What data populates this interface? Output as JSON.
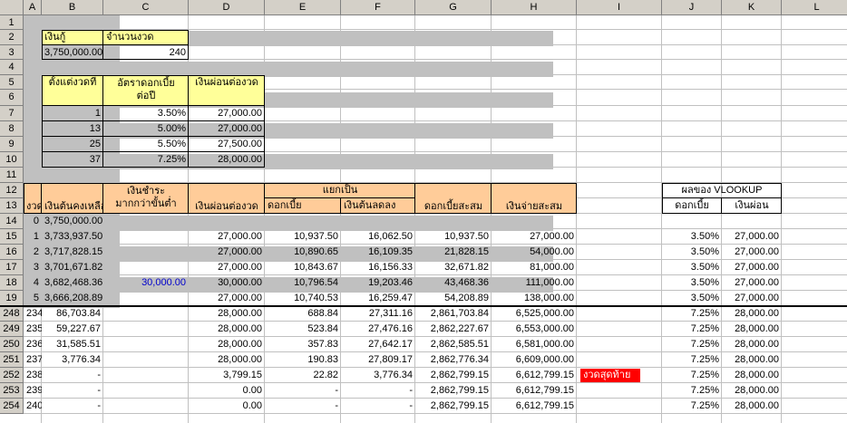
{
  "columns": [
    "A",
    "B",
    "C",
    "D",
    "E",
    "F",
    "G",
    "H",
    "I",
    "J",
    "K",
    "L"
  ],
  "row_numbers": [
    "1",
    "2",
    "3",
    "4",
    "5",
    "6",
    "7",
    "8",
    "9",
    "10",
    "11",
    "12",
    "13",
    "14",
    "15",
    "16",
    "17",
    "18",
    "19",
    "248",
    "249",
    "250",
    "251",
    "252",
    "253",
    "254"
  ],
  "loan": {
    "amount_label": "เงินกู้",
    "periods_label": "จำนวนงวด",
    "amount": "3,750,000.00",
    "periods": "240"
  },
  "rate_table": {
    "start_label": "ตั้งแต่งวดที่",
    "rate_label_1": "อัตราดอกเบี้ย",
    "rate_label_2": "ต่อปี",
    "payment_label": "เงินผ่อนต่องวด",
    "rows": [
      {
        "start": "1",
        "rate": "3.50%",
        "payment": "27,000.00"
      },
      {
        "start": "13",
        "rate": "5.00%",
        "payment": "27,000.00"
      },
      {
        "start": "25",
        "rate": "5.50%",
        "payment": "27,500.00"
      },
      {
        "start": "37",
        "rate": "7.25%",
        "payment": "28,000.00"
      }
    ]
  },
  "schedule": {
    "headers": {
      "period": "งวดที่",
      "balance": "เงินต้นคงเหลือ",
      "extra_1": "เงินชำระ",
      "extra_2": "มากกว่าขั้นต่ำ",
      "payment": "เงินผ่อนต่องวด",
      "split": "แยกเป็น",
      "interest": "ดอกเบี้ย",
      "principal": "เงินต้นลดลง",
      "cum_interest": "ดอกเบี้ยสะสม",
      "cum_paid": "เงินจ่ายสะสม"
    },
    "rows": [
      {
        "period": "0",
        "balance": "3,750,000.00",
        "extra": "",
        "payment": "",
        "interest": "",
        "principal": "",
        "cum_interest": "",
        "cum_paid": "",
        "note": "",
        "k": "",
        "l": ""
      },
      {
        "period": "1",
        "balance": "3,733,937.50",
        "extra": "",
        "payment": "27,000.00",
        "interest": "10,937.50",
        "principal": "16,062.50",
        "cum_interest": "10,937.50",
        "cum_paid": "27,000.00",
        "note": "",
        "k": "3.50%",
        "l": "27,000.00"
      },
      {
        "period": "2",
        "balance": "3,717,828.15",
        "extra": "",
        "payment": "27,000.00",
        "interest": "10,890.65",
        "principal": "16,109.35",
        "cum_interest": "21,828.15",
        "cum_paid": "54,000.00",
        "note": "",
        "k": "3.50%",
        "l": "27,000.00"
      },
      {
        "period": "3",
        "balance": "3,701,671.82",
        "extra": "",
        "payment": "27,000.00",
        "interest": "10,843.67",
        "principal": "16,156.33",
        "cum_interest": "32,671.82",
        "cum_paid": "81,000.00",
        "note": "",
        "k": "3.50%",
        "l": "27,000.00"
      },
      {
        "period": "4",
        "balance": "3,682,468.36",
        "extra": "30,000.00",
        "payment": "30,000.00",
        "interest": "10,796.54",
        "principal": "19,203.46",
        "cum_interest": "43,468.36",
        "cum_paid": "111,000.00",
        "note": "",
        "k": "3.50%",
        "l": "27,000.00"
      },
      {
        "period": "5",
        "balance": "3,666,208.89",
        "extra": "",
        "payment": "27,000.00",
        "interest": "10,740.53",
        "principal": "16,259.47",
        "cum_interest": "54,208.89",
        "cum_paid": "138,000.00",
        "note": "",
        "k": "3.50%",
        "l": "27,000.00"
      },
      {
        "period": "234",
        "balance": "86,703.84",
        "extra": "",
        "payment": "28,000.00",
        "interest": "688.84",
        "principal": "27,311.16",
        "cum_interest": "2,861,703.84",
        "cum_paid": "6,525,000.00",
        "note": "",
        "k": "7.25%",
        "l": "28,000.00"
      },
      {
        "period": "235",
        "balance": "59,227.67",
        "extra": "",
        "payment": "28,000.00",
        "interest": "523.84",
        "principal": "27,476.16",
        "cum_interest": "2,862,227.67",
        "cum_paid": "6,553,000.00",
        "note": "",
        "k": "7.25%",
        "l": "28,000.00"
      },
      {
        "period": "236",
        "balance": "31,585.51",
        "extra": "",
        "payment": "28,000.00",
        "interest": "357.83",
        "principal": "27,642.17",
        "cum_interest": "2,862,585.51",
        "cum_paid": "6,581,000.00",
        "note": "",
        "k": "7.25%",
        "l": "28,000.00"
      },
      {
        "period": "237",
        "balance": "3,776.34",
        "extra": "",
        "payment": "28,000.00",
        "interest": "190.83",
        "principal": "27,809.17",
        "cum_interest": "2,862,776.34",
        "cum_paid": "6,609,000.00",
        "note": "",
        "k": "7.25%",
        "l": "28,000.00"
      },
      {
        "period": "238",
        "balance": "-",
        "extra": "",
        "payment": "3,799.15",
        "interest": "22.82",
        "principal": "3,776.34",
        "cum_interest": "2,862,799.15",
        "cum_paid": "6,612,799.15",
        "note": "งวดสุดท้าย",
        "k": "7.25%",
        "l": "28,000.00"
      },
      {
        "period": "239",
        "balance": "-",
        "extra": "",
        "payment": "0.00",
        "interest": "-",
        "principal": "-",
        "cum_interest": "2,862,799.15",
        "cum_paid": "6,612,799.15",
        "note": "",
        "k": "7.25%",
        "l": "28,000.00"
      },
      {
        "period": "240",
        "balance": "-",
        "extra": "",
        "payment": "0.00",
        "interest": "-",
        "principal": "-",
        "cum_interest": "2,862,799.15",
        "cum_paid": "6,612,799.15",
        "note": "",
        "k": "7.25%",
        "l": "28,000.00"
      }
    ]
  },
  "vlookup": {
    "title": "ผลของ VLOOKUP",
    "rate_label": "ดอกเบี้ย",
    "payment_label": "เงินผ่อน"
  },
  "colors": {
    "header_gray": "#d4d0c8",
    "row_shade": "#c0c0c0",
    "input_yellow": "#ffff99",
    "header_orange": "#ffcc99",
    "last_period_red": "#ff0000",
    "extra_payment_blue": "#0000cc"
  }
}
